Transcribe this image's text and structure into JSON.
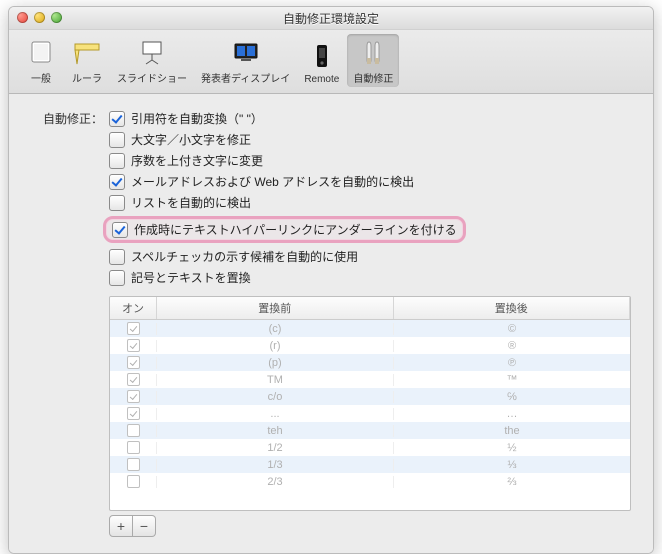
{
  "window_title": "自動修正環境設定",
  "toolbar": [
    {
      "id": "general",
      "label": "一般"
    },
    {
      "id": "ruler",
      "label": "ルーラ"
    },
    {
      "id": "slideshow",
      "label": "スライドショー"
    },
    {
      "id": "presenter",
      "label": "発表者ディスプレイ"
    },
    {
      "id": "remote",
      "label": "Remote"
    },
    {
      "id": "autofix",
      "label": "自動修正",
      "selected": true
    }
  ],
  "section_label": "自動修正：",
  "checks": [
    {
      "id": "smart-quotes",
      "label": "引用符を自動変換（\" \"）",
      "checked": true
    },
    {
      "id": "fix-case",
      "label": "大文字／小文字を修正",
      "checked": false
    },
    {
      "id": "superscript",
      "label": "序数を上付き文字に変更",
      "checked": false
    },
    {
      "id": "detect-links",
      "label": "メールアドレスおよび Web アドレスを自動的に検出",
      "checked": true
    },
    {
      "id": "detect-lists",
      "label": "リストを自動的に検出",
      "checked": false
    },
    {
      "id": "underline-links",
      "label": "作成時にテキストハイパーリンクにアンダーラインを付ける",
      "checked": true,
      "highlight": true
    },
    {
      "id": "spell-suggest",
      "label": "スペルチェッカの示す候補を自動的に使用",
      "checked": false
    },
    {
      "id": "replace-text",
      "label": "記号とテキストを置換",
      "checked": false
    }
  ],
  "table": {
    "headers": {
      "on": "オン",
      "before": "置換前",
      "after": "置換後"
    },
    "rows": [
      {
        "on": true,
        "before": "(c)",
        "after": "©"
      },
      {
        "on": true,
        "before": "(r)",
        "after": "®"
      },
      {
        "on": true,
        "before": "(p)",
        "after": "℗"
      },
      {
        "on": true,
        "before": "TM",
        "after": "™"
      },
      {
        "on": true,
        "before": "c/o",
        "after": "℅"
      },
      {
        "on": true,
        "before": "...",
        "after": "…"
      },
      {
        "on": false,
        "before": "teh",
        "after": "the"
      },
      {
        "on": false,
        "before": "1/2",
        "after": "½"
      },
      {
        "on": false,
        "before": "1/3",
        "after": "⅓"
      },
      {
        "on": false,
        "before": "2/3",
        "after": "⅔"
      }
    ],
    "add_label": "+",
    "remove_label": "−"
  }
}
